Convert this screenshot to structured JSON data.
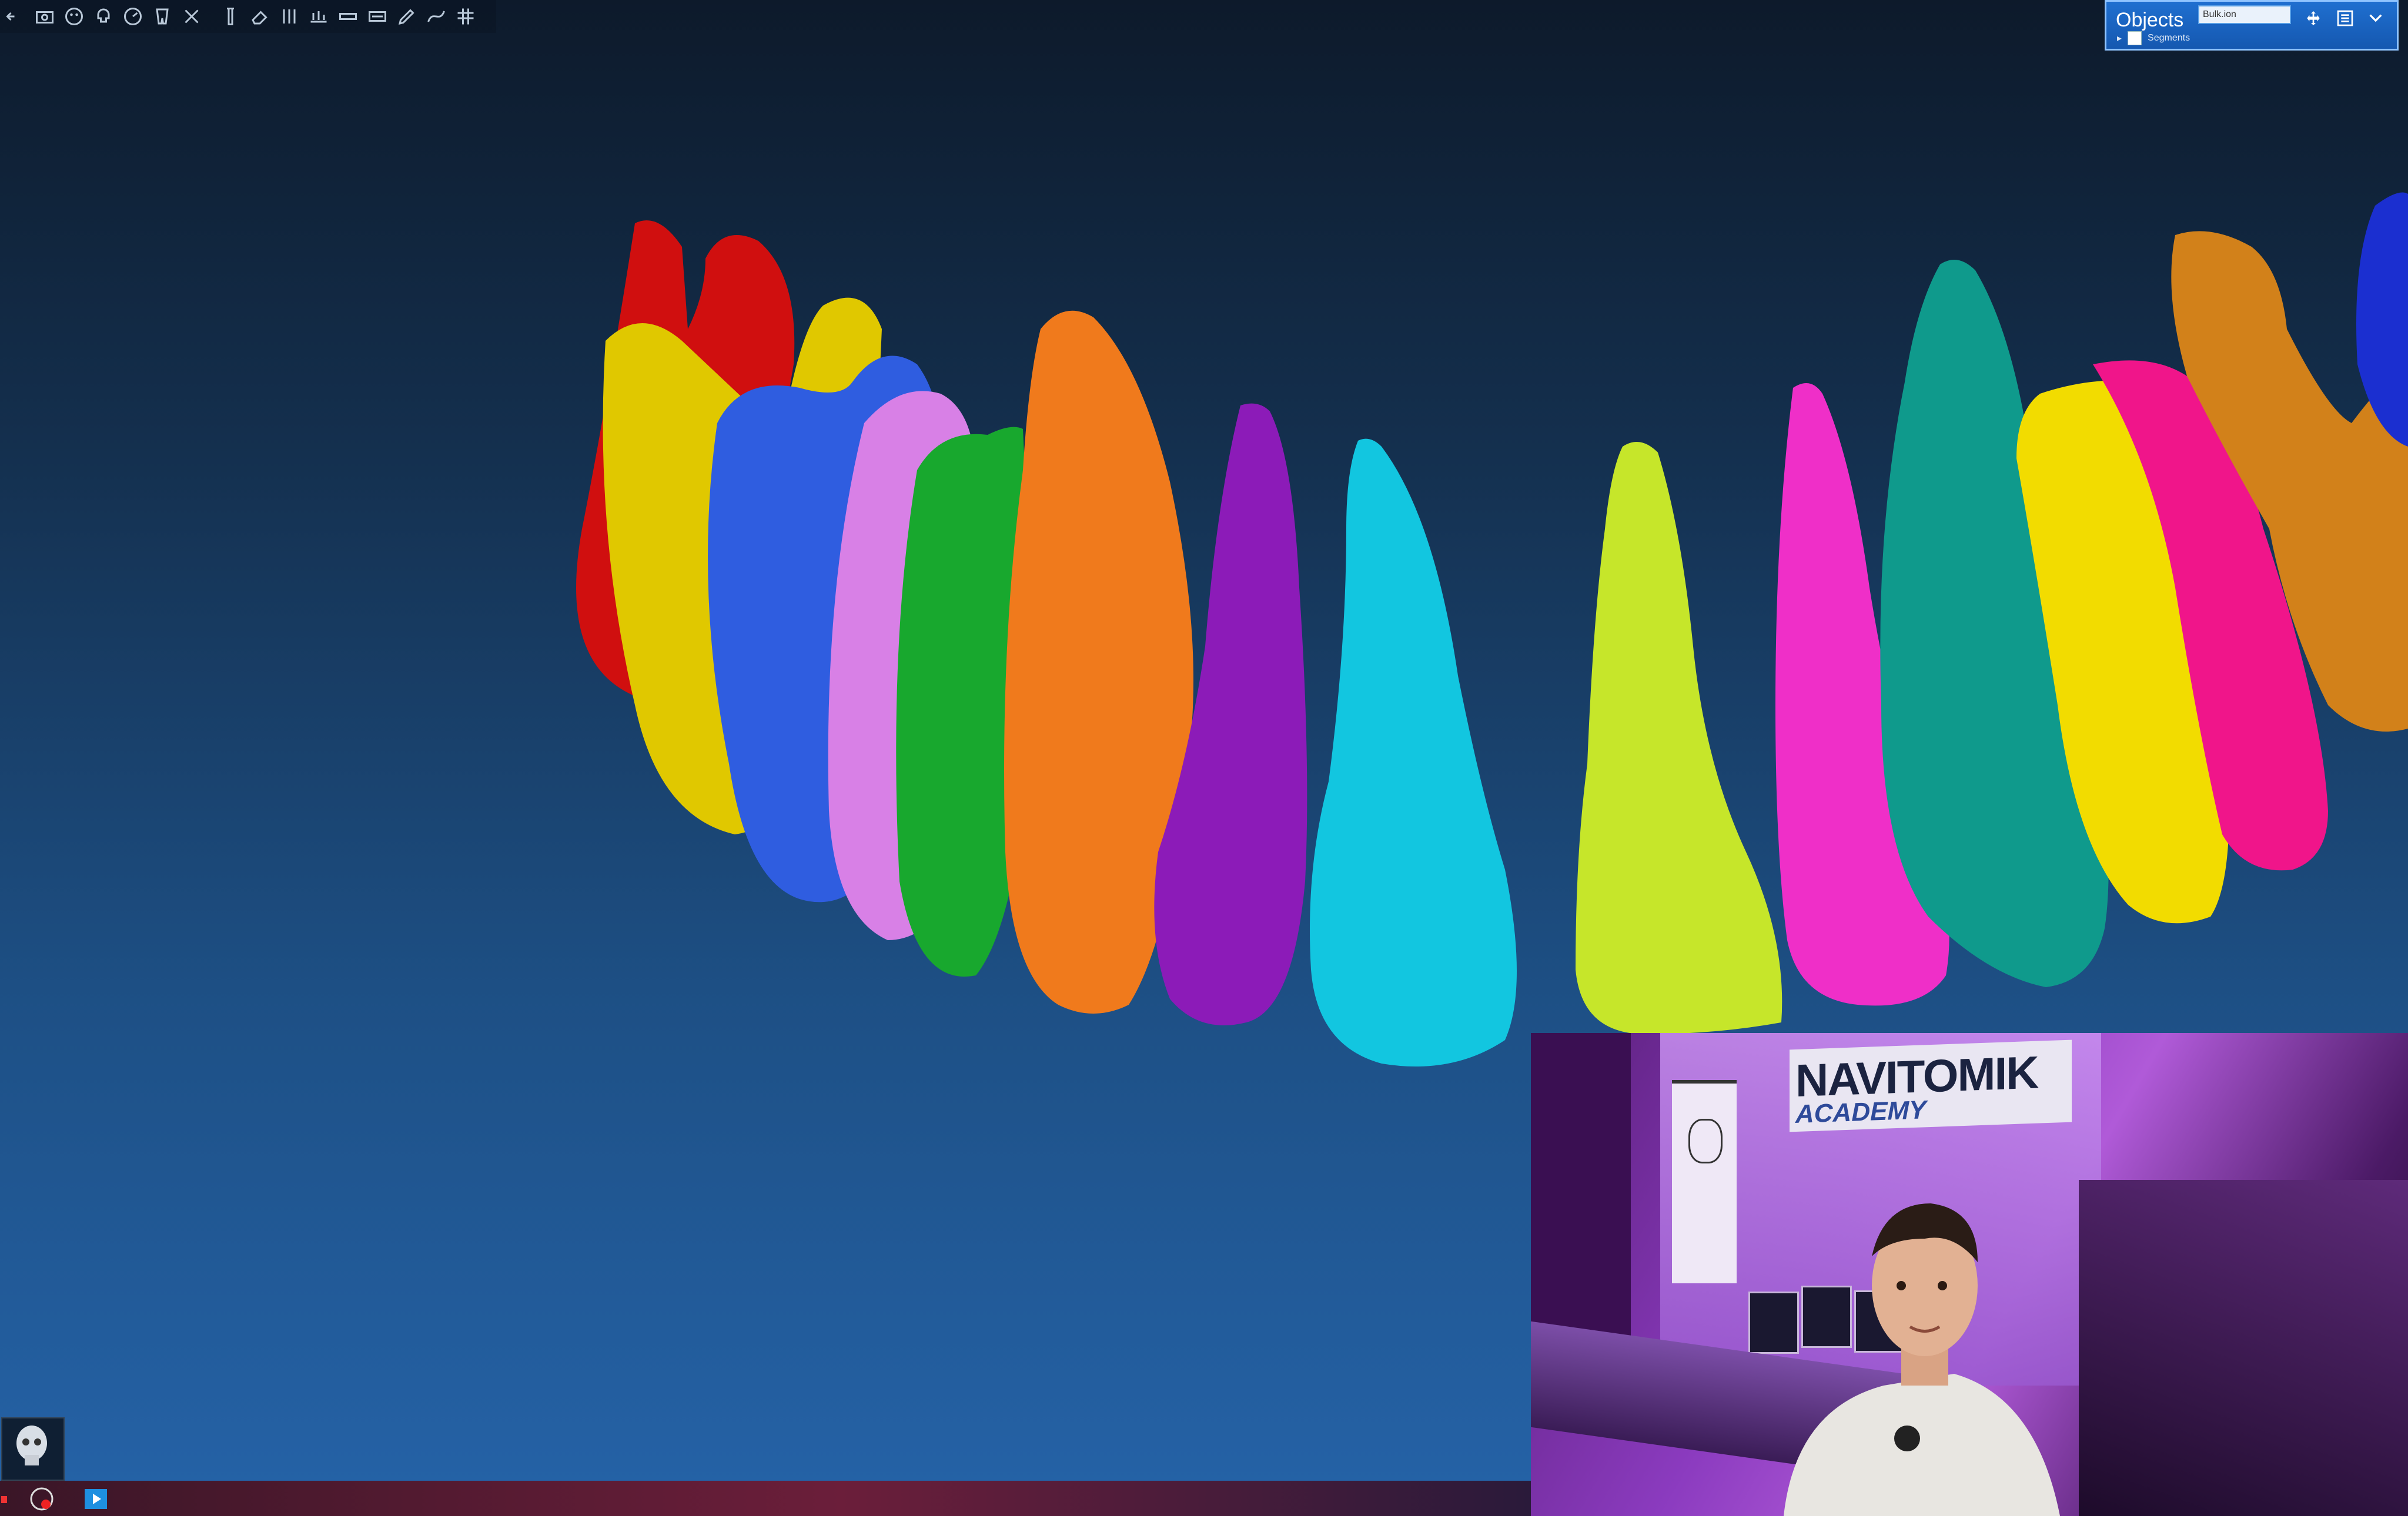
{
  "toolbar": {
    "tools": [
      "menu-icon",
      "camera-icon",
      "face-scan-icon",
      "skull-icon",
      "gauge-icon",
      "tooth-icon",
      "close-icon",
      "implant-icon",
      "eraser-icon",
      "tooth-tools-icon",
      "align-icon",
      "measure-icon",
      "panorama-icon",
      "pen-icon",
      "curve-icon",
      "grid-icon"
    ]
  },
  "objects_panel": {
    "title": "Objects",
    "search_value": "Bulk.ion",
    "tree_item": "Segments"
  },
  "webcam": {
    "sign_line1": "NAVITOMIK",
    "sign_line2": "ACADEMY"
  },
  "colors": {
    "teeth": [
      "#d00f0f",
      "#e0c800",
      "#2f5de0",
      "#d880e6",
      "#18a82e",
      "#f07a1c",
      "#8c1bb8",
      "#12c6e0",
      "#c6e62a",
      "#ef2fc8",
      "#0f9a8c",
      "#f2dc00",
      "#f0158a",
      "#d2811a"
    ]
  }
}
